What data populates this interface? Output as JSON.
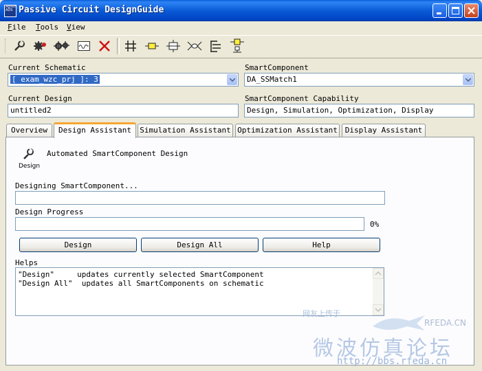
{
  "window": {
    "title": "Passive Circuit DesignGuide",
    "icon_text": "Agilent ADS"
  },
  "menu": [
    {
      "label": "File",
      "key": "F",
      "rest": "ile"
    },
    {
      "label": "Tools",
      "key": "T",
      "rest": "ools"
    },
    {
      "label": "View",
      "key": "V",
      "rest": "iew"
    }
  ],
  "toolbar": {
    "icons": [
      "design-wrench-icon",
      "gear-red-icon",
      "gears-icon",
      "waveform-icon",
      "delete-x-icon",
      "grid-lines-icon",
      "resistor-icon",
      "transmission-line-icon",
      "coupler-icon",
      "tree-icon",
      "component-icon"
    ]
  },
  "form": {
    "current_schematic_label": "Current Schematic",
    "current_schematic_value": "[ exam_wzc_prj ]: 3",
    "smartcomponent_label": "SmartComponent",
    "smartcomponent_value": "DA_SSMatch1",
    "current_design_label": "Current Design",
    "current_design_value": "untitled2",
    "capability_label": "SmartComponent Capability",
    "capability_value": "Design, Simulation, Optimization, Display"
  },
  "tabs": [
    {
      "label": "Overview",
      "active": false
    },
    {
      "label": "Design Assistant",
      "active": true
    },
    {
      "label": "Simulation Assistant",
      "active": false
    },
    {
      "label": "Optimization Assistant",
      "active": false
    },
    {
      "label": "Display Assistant",
      "active": false
    }
  ],
  "panel": {
    "design_icon_caption": "Design",
    "heading": "Automated SmartComponent Design",
    "designing_label": "Designing SmartComponent...",
    "designing_value": "",
    "progress_label": "Design Progress",
    "progress_fraction": 0.0,
    "progress_text": "0%",
    "buttons": {
      "design": "Design",
      "design_all": "Design All",
      "help": "Help"
    },
    "helps_label": "Helps",
    "helps_lines": [
      "\"Design\"     updates currently selected SmartComponent",
      "\"Design All\"  updates all SmartComponents on schematic"
    ]
  },
  "watermark": {
    "site_name": "RFEDA.CN",
    "chinese": "微波仿真论坛",
    "url": "http://bbs.rfeda.cn",
    "small": "网友上传于"
  },
  "colors": {
    "titlebar": "#0a5bd5",
    "tab_active_accent": "#f7a634",
    "face": "#ece9d8"
  }
}
